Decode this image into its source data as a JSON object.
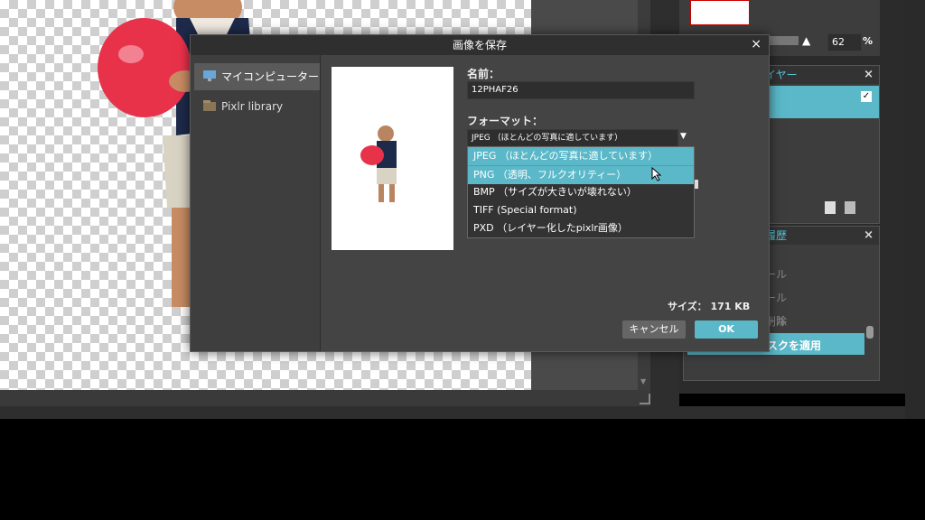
{
  "editor": {
    "zoom_value": "62",
    "zoom_unit": "%"
  },
  "layers_panel": {
    "title": "イヤー",
    "close": "×"
  },
  "history_panel": {
    "title": "履歴",
    "close": "×",
    "items": [
      "ール",
      "ール",
      "ール",
      "削除",
      "スクを適用"
    ]
  },
  "dialog": {
    "title": "画像を保存",
    "close": "×",
    "locations": [
      {
        "label": "マイコンピューター",
        "icon": "monitor-icon"
      },
      {
        "label": "Pixlr library",
        "icon": "library-icon"
      }
    ],
    "name_label": "名前：",
    "name_value": "12PHAF26",
    "format_label": "フォーマット：",
    "format_value": "JPEG （ほとんどの写真に適しています）",
    "format_options": [
      "JPEG （ほとんどの写真に適しています）",
      "PNG （透明、フルクオリティー）",
      "BMP （サイズが大きいが壊れない）",
      "TIFF (Special format)",
      "PXD （レイヤー化したpixlr画像）"
    ],
    "size_text": "サイズ： 171 KB",
    "cancel_label": "キャンセル",
    "ok_label": "OK"
  },
  "colors": {
    "accent": "#5ab8c8",
    "dialog_bg": "#444444",
    "balloon": "#e8324a"
  }
}
